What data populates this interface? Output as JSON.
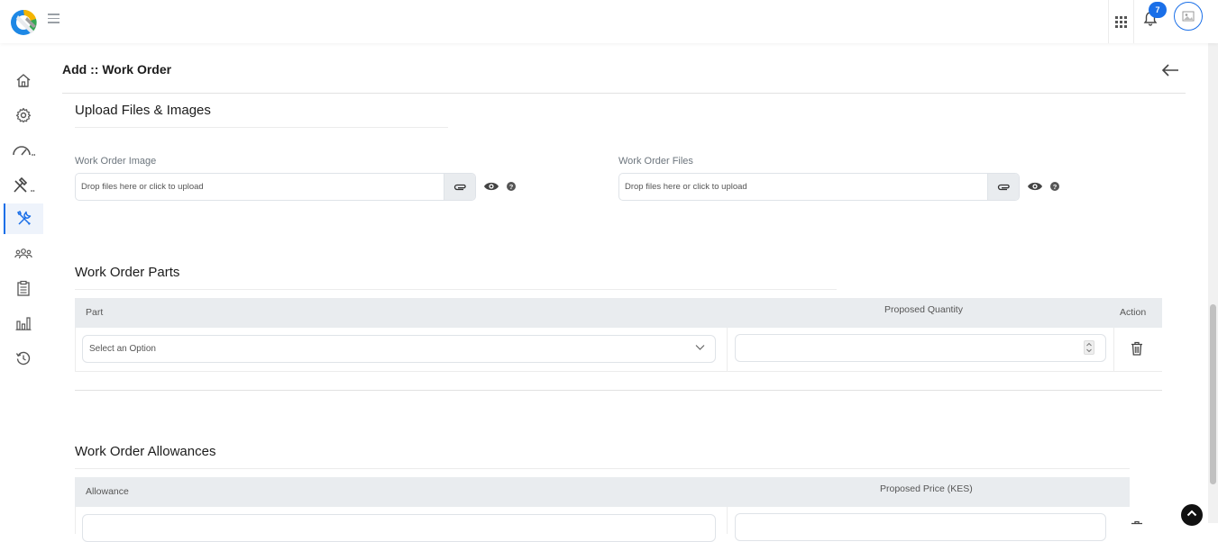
{
  "topbar": {
    "notification_count": "7"
  },
  "sidebar": {
    "items": [
      {
        "name": "home-icon"
      },
      {
        "name": "gear-icon"
      },
      {
        "name": "gauge-icon"
      },
      {
        "name": "tools-icon"
      },
      {
        "name": "wrench-screwdriver-icon",
        "active": true
      },
      {
        "name": "users-icon"
      },
      {
        "name": "clipboard-icon"
      },
      {
        "name": "bar-chart-icon"
      },
      {
        "name": "history-icon"
      }
    ],
    "active_color": "#1a6fe8"
  },
  "page": {
    "title": "Add :: Work Order"
  },
  "upload_section": {
    "title": "Upload Files & Images",
    "image_field": {
      "label": "Work Order Image",
      "placeholder": "Drop files here or click to upload"
    },
    "files_field": {
      "label": "Work Order Files",
      "placeholder": "Drop files here or click to upload"
    }
  },
  "parts_section": {
    "title": "Work Order Parts",
    "columns": [
      "Part",
      "Proposed Quantity",
      "Action"
    ],
    "row": {
      "part_placeholder": "Select an Option",
      "quantity_value": ""
    }
  },
  "allowances_section": {
    "title": "Work Order Allowances",
    "columns": [
      "Allowance",
      "Proposed Price (KES)"
    ]
  }
}
